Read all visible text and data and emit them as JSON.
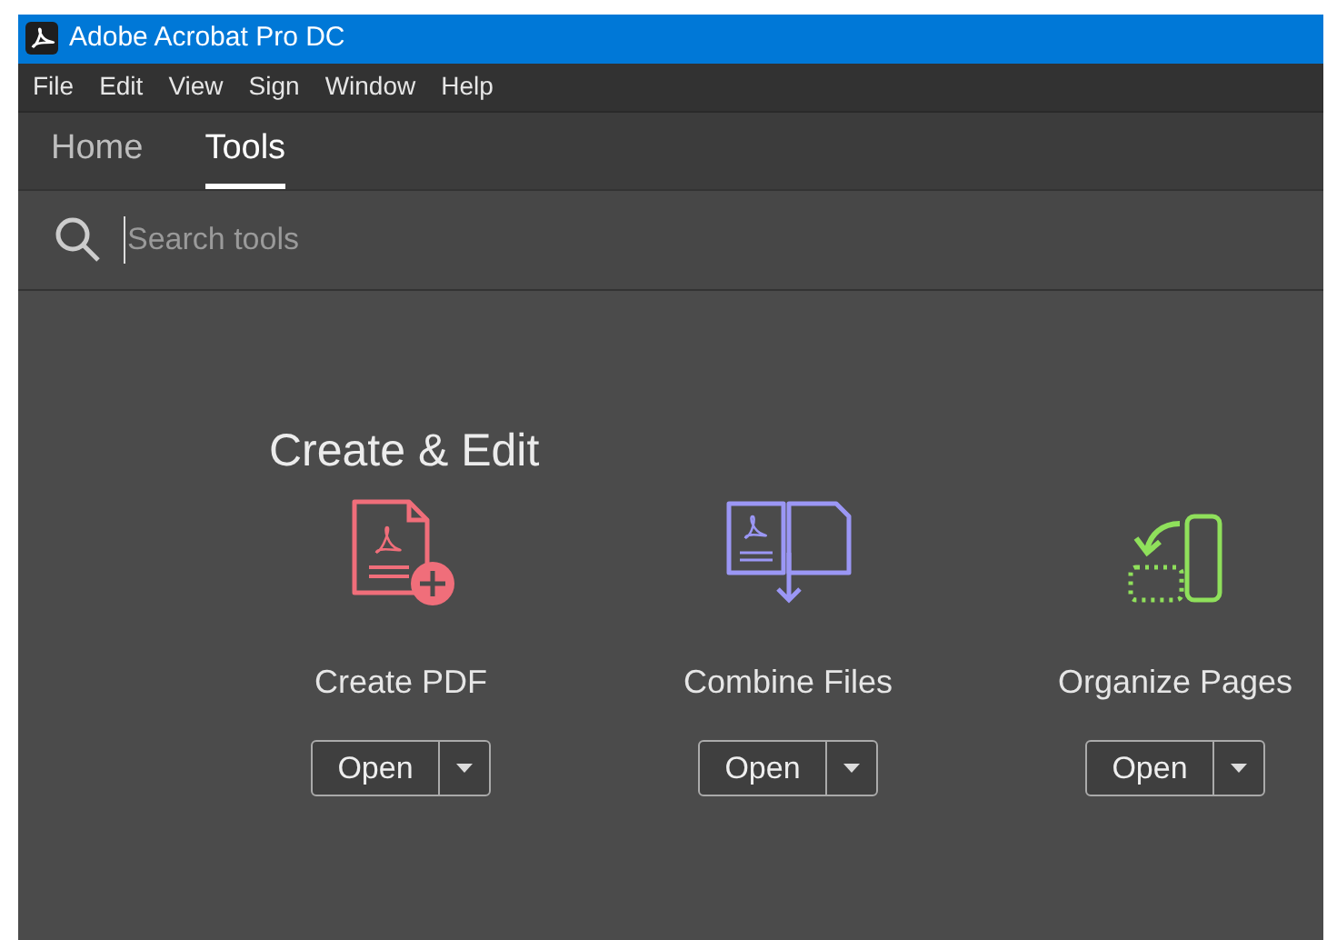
{
  "window": {
    "title": "Adobe Acrobat Pro DC"
  },
  "menu": [
    "File",
    "Edit",
    "View",
    "Sign",
    "Window",
    "Help"
  ],
  "tabs": [
    {
      "label": "Home",
      "selected": false
    },
    {
      "label": "Tools",
      "selected": true
    }
  ],
  "search": {
    "placeholder": "Search tools"
  },
  "section": {
    "title": "Create & Edit"
  },
  "tools": [
    {
      "kind": "create",
      "label": "Create PDF",
      "button": "Open"
    },
    {
      "kind": "combine",
      "label": "Combine Files",
      "button": "Open"
    },
    {
      "kind": "organize",
      "label": "Organize Pages",
      "button": "Open"
    }
  ]
}
